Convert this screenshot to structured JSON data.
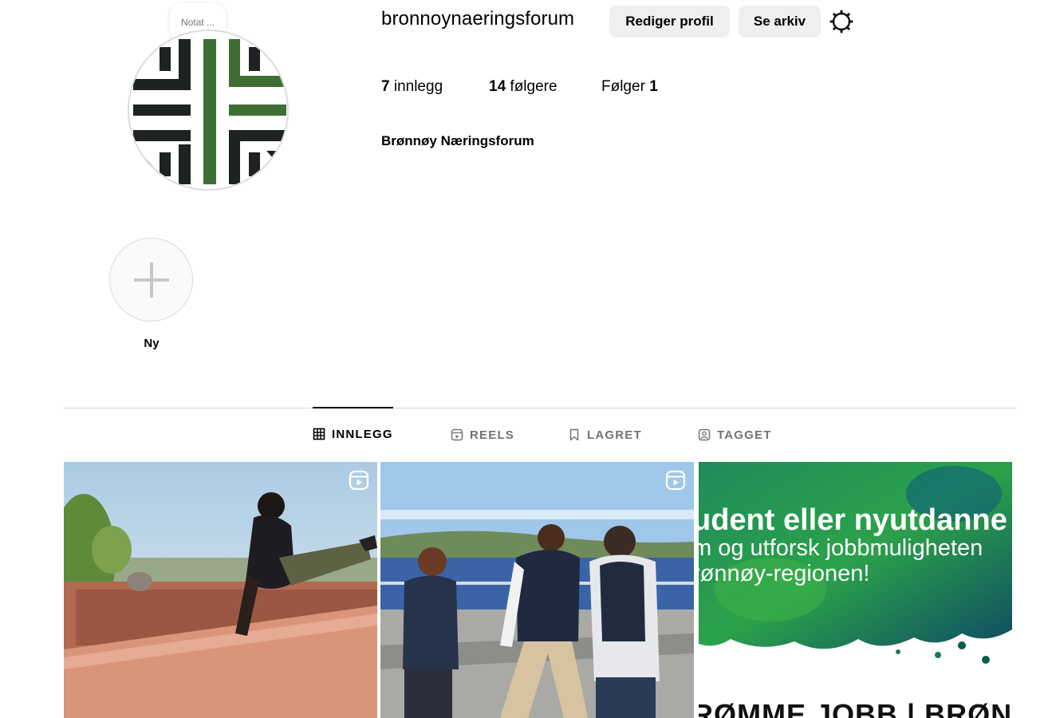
{
  "profile": {
    "note_label": "Notat ...",
    "username": "bronnoynaeringsforum",
    "edit_profile_label": "Rediger profil",
    "archive_label": "Se arkiv",
    "full_name": "Brønnøy Næringsforum",
    "logo_colors": {
      "dark": "#1f2320",
      "green": "#3f6e35"
    }
  },
  "stats": {
    "posts_count": "7",
    "posts_label": " innlegg",
    "followers_count": "14",
    "followers_label": " følgere",
    "following_label": "Følger ",
    "following_count": "1"
  },
  "highlights": {
    "new_label": "Ny"
  },
  "tabs": [
    {
      "label": "INNLEGG",
      "icon": "grid-icon",
      "active": true
    },
    {
      "label": "REELS",
      "icon": "reels-icon",
      "active": false
    },
    {
      "label": "LAGRET",
      "icon": "bookmark-icon",
      "active": false
    },
    {
      "label": "TAGGET",
      "icon": "tag-person-icon",
      "active": false
    }
  ],
  "posts": [
    {
      "type": "reel",
      "description_icon": "reel-icon"
    },
    {
      "type": "reel",
      "description_icon": "reel-icon"
    },
    {
      "type": "image",
      "text_line_1": "udent eller nyutdanne",
      "text_line_2": "m og utforsk jobbmuligheten",
      "text_line_3": "rønnøy-regionen!",
      "text_line_4": "RØMME JOBB | BRØNNØ"
    }
  ]
}
